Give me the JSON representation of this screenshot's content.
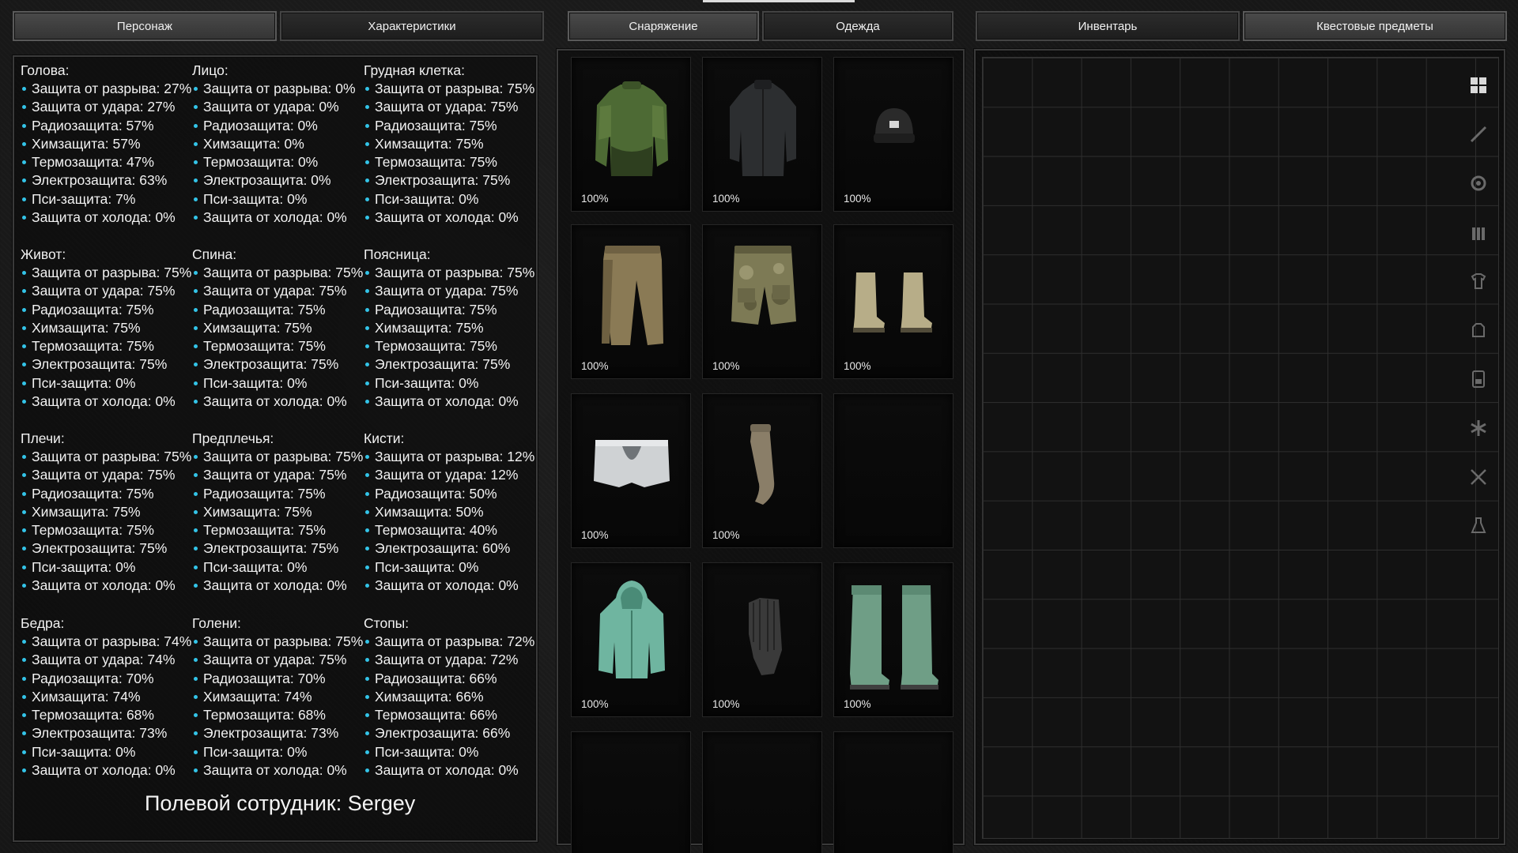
{
  "tabs": {
    "left": [
      "Персонаж",
      "Характеристики"
    ],
    "middle": [
      "Снаряжение",
      "Одежда"
    ],
    "right": [
      "Инвентарь",
      "Квестовые предметы"
    ]
  },
  "stat_labels": {
    "tear": "Защита от разрыва",
    "impact": "Защита от удара",
    "radio": "Радиозащита",
    "chem": "Химзащита",
    "thermo": "Термозащита",
    "electro": "Электрозащита",
    "psi": "Пси-защита",
    "cold": "Защита от холода"
  },
  "body_parts": [
    {
      "name": "Голова:",
      "stats": [
        "Защита от разрыва: 27%",
        "Защита от удара: 27%",
        "Радиозащита: 57%",
        "Химзащита: 57%",
        "Термозащита: 47%",
        "Электрозащита: 63%",
        "Пси-защита: 7%",
        "Защита от холода: 0%"
      ]
    },
    {
      "name": "Лицо:",
      "stats": [
        "Защита от разрыва: 0%",
        "Защита от удара: 0%",
        "Радиозащита: 0%",
        "Химзащита: 0%",
        "Термозащита: 0%",
        "Электрозащита: 0%",
        "Пси-защита: 0%",
        "Защита от холода: 0%"
      ]
    },
    {
      "name": "Грудная клетка:",
      "stats": [
        "Защита от разрыва: 75%",
        "Защита от удара: 75%",
        "Радиозащита: 75%",
        "Химзащита: 75%",
        "Термозащита: 75%",
        "Электрозащита: 75%",
        "Пси-защита: 0%",
        "Защита от холода: 0%"
      ]
    },
    {
      "name": "Живот:",
      "stats": [
        "Защита от разрыва: 75%",
        "Защита от удара: 75%",
        "Радиозащита: 75%",
        "Химзащита: 75%",
        "Термозащита: 75%",
        "Электрозащита: 75%",
        "Пси-защита: 0%",
        "Защита от холода: 0%"
      ]
    },
    {
      "name": "Спина:",
      "stats": [
        "Защита от разрыва: 75%",
        "Защита от удара: 75%",
        "Радиозащита: 75%",
        "Химзащита: 75%",
        "Термозащита: 75%",
        "Электрозащита: 75%",
        "Пси-защита: 0%",
        "Защита от холода: 0%"
      ]
    },
    {
      "name": "Поясница:",
      "stats": [
        "Защита от разрыва: 75%",
        "Защита от удара: 75%",
        "Радиозащита: 75%",
        "Химзащита: 75%",
        "Термозащита: 75%",
        "Электрозащита: 75%",
        "Пси-защита: 0%",
        "Защита от холода: 0%"
      ]
    },
    {
      "name": "Плечи:",
      "stats": [
        "Защита от разрыва: 75%",
        "Защита от удара: 75%",
        "Радиозащита: 75%",
        "Химзащита: 75%",
        "Термозащита: 75%",
        "Электрозащита: 75%",
        "Пси-защита: 0%",
        "Защита от холода: 0%"
      ]
    },
    {
      "name": "Предплечья:",
      "stats": [
        "Защита от разрыва: 75%",
        "Защита от удара: 75%",
        "Радиозащита: 75%",
        "Химзащита: 75%",
        "Термозащита: 75%",
        "Электрозащита: 75%",
        "Пси-защита: 0%",
        "Защита от холода: 0%"
      ]
    },
    {
      "name": "Кисти:",
      "stats": [
        "Защита от разрыва: 12%",
        "Защита от удара: 12%",
        "Радиозащита: 50%",
        "Химзащита: 50%",
        "Термозащита: 40%",
        "Электрозащита: 60%",
        "Пси-защита: 0%",
        "Защита от холода: 0%"
      ]
    },
    {
      "name": "Бедра:",
      "stats": [
        "Защита от разрыва: 74%",
        "Защита от удара: 74%",
        "Радиозащита: 70%",
        "Химзащита: 74%",
        "Термозащита: 68%",
        "Электрозащита: 73%",
        "Пси-защита: 0%",
        "Защита от холода: 0%"
      ]
    },
    {
      "name": "Голени:",
      "stats": [
        "Защита от разрыва: 75%",
        "Защита от удара: 75%",
        "Радиозащита: 70%",
        "Химзащита: 74%",
        "Термозащита: 68%",
        "Электрозащита: 73%",
        "Пси-защита: 0%",
        "Защита от холода: 0%"
      ]
    },
    {
      "name": "Стопы:",
      "stats": [
        "Защита от разрыва: 72%",
        "Защита от удара: 72%",
        "Радиозащита: 66%",
        "Химзащита: 66%",
        "Термозащита: 66%",
        "Электрозащита: 66%",
        "Пси-защита: 0%",
        "Защита от холода: 0%"
      ]
    }
  ],
  "operative": "Полевой сотрудник: Sergey",
  "equipment_slots": [
    {
      "item": "green-shirt-icon",
      "condition": "100%",
      "color": "#4d6a34"
    },
    {
      "item": "dark-jacket-icon",
      "condition": "100%",
      "color": "#2c2e30"
    },
    {
      "item": "beanie-icon",
      "condition": "100%",
      "color": "#2a2a2a"
    },
    {
      "item": "khaki-pants-icon",
      "condition": "100%",
      "color": "#8a7a55"
    },
    {
      "item": "camo-shorts-icon",
      "condition": "100%",
      "color": "#7d7a55"
    },
    {
      "item": "boots-icon",
      "condition": "100%",
      "color": "#b7ad88"
    },
    {
      "item": "underwear-icon",
      "condition": "100%",
      "color": "#cfd2d4"
    },
    {
      "item": "sock-icon",
      "condition": "100%",
      "color": "#8a7e68"
    },
    {
      "item": "",
      "condition": "",
      "color": ""
    },
    {
      "item": "hazmat-jacket-icon",
      "condition": "100%",
      "color": "#6fb5a0"
    },
    {
      "item": "gloves-icon",
      "condition": "100%",
      "color": "#3a3a3a"
    },
    {
      "item": "hazmat-boots-icon",
      "condition": "100%",
      "color": "#6f9e86"
    },
    {
      "item": "",
      "condition": "",
      "color": ""
    },
    {
      "item": "",
      "condition": "",
      "color": ""
    },
    {
      "item": "",
      "condition": "",
      "color": ""
    }
  ],
  "inventory_filters": [
    "grid-icon",
    "knife-icon",
    "gear-icon",
    "ammo-icon",
    "shirt-icon",
    "armor-icon",
    "device-icon",
    "asterisk-icon",
    "tools-icon",
    "flask-icon"
  ],
  "accent": "#33c4e8"
}
